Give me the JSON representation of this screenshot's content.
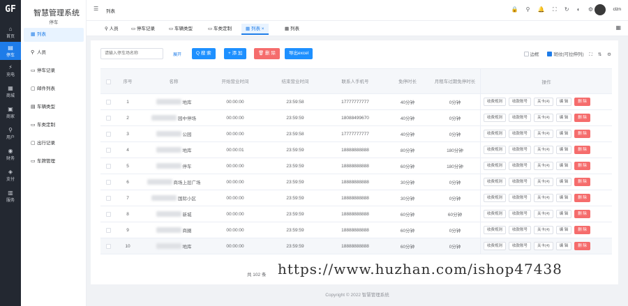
{
  "app": {
    "logo_text": "GF",
    "title": "智慧管理系统",
    "subtitle": "停车"
  },
  "rail": [
    {
      "label": "首页",
      "icon": "⌂"
    },
    {
      "label": "停车",
      "icon": "▤"
    },
    {
      "label": "充电",
      "icon": "⚡"
    },
    {
      "label": "商城",
      "icon": "▦"
    },
    {
      "label": "商家",
      "icon": "▣"
    },
    {
      "label": "用户",
      "icon": "⚲"
    },
    {
      "label": "财务",
      "icon": "◉"
    },
    {
      "label": "支付",
      "icon": "◈"
    },
    {
      "label": "服务",
      "icon": "▥"
    }
  ],
  "side_menu": [
    {
      "label": "列表",
      "icon": "▦"
    },
    {
      "label": "人员",
      "icon": "⚲"
    },
    {
      "label": "停车记录",
      "icon": "▭"
    },
    {
      "label": "邮件列表",
      "icon": "▢"
    },
    {
      "label": "车辆类型",
      "icon": "▤"
    },
    {
      "label": "车类定制",
      "icon": "▭"
    },
    {
      "label": "出行记录",
      "icon": "▢"
    },
    {
      "label": "车牌管理",
      "icon": "▭"
    }
  ],
  "header": {
    "breadcrumb": "列表",
    "user": "clzn"
  },
  "tabs": [
    {
      "label": "人员"
    },
    {
      "label": "停车记录"
    },
    {
      "label": "车辆类型"
    },
    {
      "label": "车类定制"
    },
    {
      "label": "列表",
      "close": "×"
    },
    {
      "label": "列表"
    }
  ],
  "toolbar": {
    "search_placeholder": "请输入停车场名称",
    "expand": "展开",
    "btn_search": "Q 搜 索",
    "btn_add": "+ 添 加",
    "btn_delete": "🗑 删 除",
    "btn_export": "导出excel",
    "check_bordered": "边框",
    "check_stripe": "斑纹(可拉伸列)"
  },
  "columns": {
    "no": "序号",
    "name": "名称",
    "open_time": "开始营业时间",
    "close_time": "结束营业时间",
    "phone": "联系人手机号",
    "free_time": "免停时长",
    "monthly": "月租车过期免停时长",
    "ops": "操作"
  },
  "rows": [
    {
      "no": "1",
      "name": "地库",
      "open": "00:00:00",
      "close": "23:59:58",
      "phone": "17777777777",
      "free": "40分钟",
      "monthly": "0分钟"
    },
    {
      "no": "2",
      "name": "园中停场",
      "open": "00:00:00",
      "close": "23:59:59",
      "phone": "18088499670",
      "free": "40分钟",
      "monthly": "0分钟"
    },
    {
      "no": "3",
      "name": "公园",
      "open": "00:00:00",
      "close": "23:59:58",
      "phone": "17777777777",
      "free": "40分钟",
      "monthly": "0分钟"
    },
    {
      "no": "4",
      "name": "地库",
      "open": "00:00:01",
      "close": "23:59:59",
      "phone": "18888888888",
      "free": "80分钟",
      "monthly": "180分钟"
    },
    {
      "no": "5",
      "name": "停车",
      "open": "00:00:00",
      "close": "23:59:59",
      "phone": "18888888888",
      "free": "60分钟",
      "monthly": "180分钟"
    },
    {
      "no": "6",
      "name": "商场上层广场",
      "open": "00:00:00",
      "close": "23:59:59",
      "phone": "18888888888",
      "free": "30分钟",
      "monthly": "0分钟"
    },
    {
      "no": "7",
      "name": "国际小区",
      "open": "00:00:00",
      "close": "23:59:59",
      "phone": "18888888888",
      "free": "30分钟",
      "monthly": "0分钟"
    },
    {
      "no": "8",
      "name": "新城",
      "open": "00:00:00",
      "close": "23:59:59",
      "phone": "18888888888",
      "free": "60分钟",
      "monthly": "60分钟"
    },
    {
      "no": "9",
      "name": "商圈",
      "open": "00:00:00",
      "close": "23:59:59",
      "phone": "18888888888",
      "free": "60分钟",
      "monthly": "0分钟"
    },
    {
      "no": "10",
      "name": "地库",
      "open": "00:00:00",
      "close": "23:59:59",
      "phone": "18888888888",
      "free": "60分钟",
      "monthly": "0分钟"
    }
  ],
  "row_actions": {
    "a1": "收费规则",
    "a2": "收款账号",
    "a3": "关卡(4)",
    "edit": "编 辑",
    "del": "删 除"
  },
  "pagination": {
    "total": "共 102 条"
  },
  "footer": "Copyright © 2022 智慧管理系统",
  "watermark": "https://www.huzhan.com/ishop47438"
}
